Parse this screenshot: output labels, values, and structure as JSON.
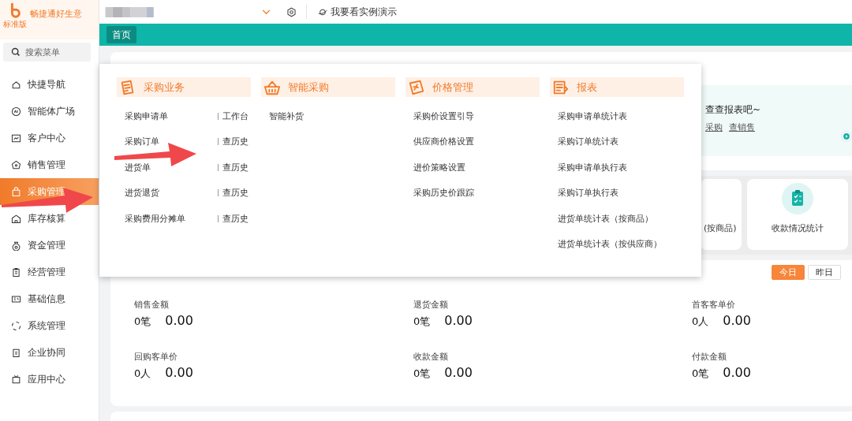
{
  "app": {
    "logo_text": "畅捷通好生意",
    "edition": "标准版"
  },
  "search": {
    "placeholder": "搜索菜单"
  },
  "sidebar": {
    "items": [
      {
        "label": "快捷导航",
        "selected": false
      },
      {
        "label": "智能体广场",
        "selected": false
      },
      {
        "label": "客户中心",
        "selected": false
      },
      {
        "label": "销售管理",
        "selected": false
      },
      {
        "label": "采购管理",
        "selected": true
      },
      {
        "label": "库存核算",
        "selected": false
      },
      {
        "label": "资金管理",
        "selected": false
      },
      {
        "label": "经营管理",
        "selected": false
      },
      {
        "label": "基础信息",
        "selected": false
      },
      {
        "label": "系统管理",
        "selected": false
      },
      {
        "label": "企业协同",
        "selected": false
      },
      {
        "label": "应用中心",
        "selected": false
      }
    ]
  },
  "topbar": {
    "demo_link": "我要看实例演示"
  },
  "tabs": [
    {
      "label": "首页",
      "selected": true
    }
  ],
  "mega_menu": {
    "groups": [
      {
        "title": "采购业务",
        "items": [
          {
            "label": "采购申请单",
            "shortcut": "工作台"
          },
          {
            "label": "采购订单",
            "shortcut": "查历史"
          },
          {
            "label": "进货单",
            "shortcut": "查历史"
          },
          {
            "label": "进货退货",
            "shortcut": "查历史"
          },
          {
            "label": "采购费用分摊单",
            "shortcut": "查历史"
          }
        ]
      },
      {
        "title": "智能采购",
        "items": [
          {
            "label": "智能补货"
          }
        ]
      },
      {
        "title": "价格管理",
        "items": [
          {
            "label": "采购价设置引导"
          },
          {
            "label": "供应商价格设置"
          },
          {
            "label": "进价策略设置"
          },
          {
            "label": "采购历史价跟踪"
          }
        ]
      },
      {
        "title": "报表",
        "items": [
          {
            "label": "采购申请单统计表"
          },
          {
            "label": "采购订单统计表"
          },
          {
            "label": "采购申请单执行表"
          },
          {
            "label": "采购订单执行表"
          },
          {
            "label": "进货单统计表（按商品）"
          },
          {
            "label": "进货单统计表（按供应商）"
          }
        ]
      }
    ]
  },
  "banner": {
    "text": "查查报表吧~",
    "links": [
      "采购",
      "查销售"
    ]
  },
  "report_cards": [
    {
      "label": "(按商品)"
    },
    {
      "label": "收款情况统计"
    }
  ],
  "stats": {
    "periods": [
      {
        "label": "今日",
        "selected": true
      },
      {
        "label": "昨日",
        "selected": false
      }
    ],
    "metrics": [
      {
        "label": "销售金额",
        "count": "0笔",
        "amount": "0.00"
      },
      {
        "label": "退货金额",
        "count": "0笔",
        "amount": "0.00"
      },
      {
        "label": "首客客单价",
        "count": "0人",
        "amount": "0.00"
      },
      {
        "label": "回购客单价",
        "count": "0人",
        "amount": "0.00"
      },
      {
        "label": "收款金额",
        "count": "0笔",
        "amount": "0.00"
      },
      {
        "label": "付款金额",
        "count": "0笔",
        "amount": "0.00"
      }
    ]
  }
}
